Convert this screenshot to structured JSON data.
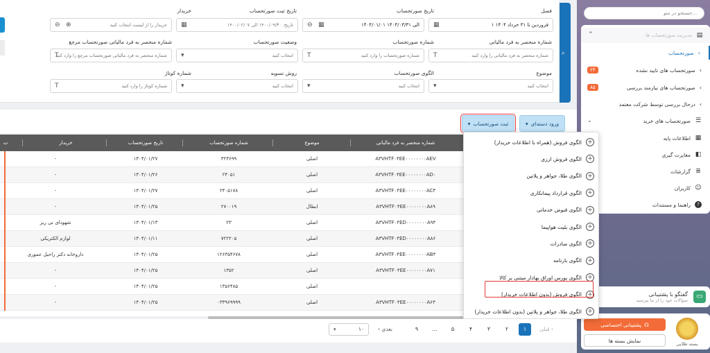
{
  "sidebar": {
    "search_placeholder": "جستجو در منو...",
    "group_faded": "مدیریت صورتحساب ها",
    "items": [
      {
        "label": "صورتحساب"
      },
      {
        "label": "صورتحساب های تایید نشده",
        "badge": "۲۳"
      },
      {
        "label": "صورتحساب های نیازمند بررسی",
        "badge": "۸۵"
      },
      {
        "label": "درحال بررسی توسط شرکت معتمد"
      },
      {
        "label": "صورتحساب های خرید"
      },
      {
        "label": "اطلاعات پایه"
      },
      {
        "label": "مغایرت گیری"
      },
      {
        "label": "گزارشات"
      },
      {
        "label": "کاربران"
      },
      {
        "label": "راهنما و مستندات"
      }
    ],
    "chat": {
      "title": "گفتگو با پشتیبانی",
      "subtitle": "سوالات خود را از ما بپرسید"
    },
    "package": {
      "support_button": "پشتیبانی اختصاصی",
      "show_button": "نمایش بسته ها",
      "medal_label": "بسته طلایی"
    }
  },
  "filters": {
    "row1": {
      "season": {
        "label": "فصل",
        "value": "۱ فروردین تا ۳۱ خرداد ۱۴۰۴"
      },
      "invoice_date": {
        "label": "تاریخ صورتحساب",
        "value": "۱۴۰۴/۰۱/۰۱ الی ۱۴۰۴/۰۳/۳۱"
      },
      "register_date": {
        "label": "تاریخ ثبت صورتحساب",
        "value": "تاریخ: ۱۴۰۰/۰۹/۳۰ الی ۱۴۰۰/۰۲/۰۷"
      },
      "buyer": {
        "label": "خریدار",
        "placeholder": "خریدار را از لیست انتخاب کنید"
      }
    },
    "row2": {
      "tax_number": {
        "label": "شماره منحصر به فرد مالیاتی",
        "placeholder": "شماره منحصر به فرد مالیاتی را وارد کنید"
      },
      "invoice_number": {
        "label": "شماره صورتحساب",
        "placeholder": "شماره صورتحساب را وارد کنید"
      },
      "status": {
        "label": "وضعیت صورتحساب",
        "placeholder": "انتخاب کنید"
      },
      "ref_tax_number": {
        "label": "شماره منحصر به فرد مالیاتی صورتحساب مرجع",
        "placeholder": "شماره منحصر به فرد مالیاتی صورتحساب مرجع را وارد کنید"
      }
    },
    "row3": {
      "subject": {
        "label": "موضوع",
        "placeholder": "انتخاب کنید"
      },
      "pattern": {
        "label": "الگوی صورتحساب",
        "placeholder": "انتخاب کنید"
      },
      "settlement": {
        "label": "روش تسویه",
        "placeholder": "انتخاب کنید"
      },
      "customs": {
        "label": "شماره کوتاژ",
        "placeholder": "شماره کوتاژ را وارد کنید"
      }
    }
  },
  "toolbar": {
    "group_import": "ورود دسته‌ای",
    "register_invoice": "ثبت صورتحساب"
  },
  "table": {
    "headers": {
      "tax_no": "شماره منحصر به فرد مالیاتی",
      "subject": "موضوع",
      "invoice_no": "شماره صورتحساب",
      "date": "تاریخ صورتحساب",
      "buyer": "خریدار",
      "col_first": "ت"
    },
    "rows": [
      {
        "tax_no": "A۳VHTF۰۴EE۰۰۰۰۰۰۰۰AEV",
        "subject": "اصلی",
        "invoice_no": "۳۲۳۶۹۹",
        "date": "۱۴۰۴/۰۱/۲۷",
        "buyer": "-"
      },
      {
        "tax_no": "A۳VHTF۰۴EE۰۰۰۰۰۰۰۰AD۰",
        "subject": "اصلی",
        "invoice_no": "۲۴۰۵۱",
        "date": "۱۴۰۴/۰۱/۲۶",
        "buyer": "-"
      },
      {
        "tax_no": "A۳VHTF۰۴EE۰۰۰۰۰۰۰۰AC۳",
        "subject": "اصلی",
        "invoice_no": "۲۴۰۵۱۷۸",
        "date": "۱۴۰۴/۰۱/۲۷",
        "buyer": "-"
      },
      {
        "tax_no": "A۳VHTF۰۴EE۰۰۰۰۰۰۰۰A۸۹",
        "subject": "ابطال",
        "invoice_no": "۲۷۰۰۱۹",
        "date": "۱۴۰۴/۰۱/۲۵",
        "buyer": "-"
      },
      {
        "tax_no": "A۳VHTF۰۴ED۰۰۰۰۰۰۰۰A۹۴",
        "subject": "اصلی",
        "invoice_no": "۲۳",
        "date": "۱۴۰۴/۰۱/۱۳",
        "buyer": "شهودای نی ریز"
      },
      {
        "tax_no": "A۳VHTF۰۴ED۰۰۰۰۰۰۰۰A۸۶",
        "subject": "اصلی",
        "invoice_no": "۷۲۲۲۰۵",
        "date": "۱۴۰۴/۰۱/۱۱",
        "buyer": "لوازم الکتریکی"
      },
      {
        "tax_no": "A۳VHTF۰۴EE۰۰۰۰۰۰۰۰AB۳",
        "subject": "اصلی",
        "invoice_no": "۱۲۶۳۵۴۶۷۸",
        "date": "۱۴۰۴/۰۱/۲۵",
        "buyer": "داروخانه دکتر راحیل عموری"
      },
      {
        "tax_no": "A۳VHTF۰۴EE۰۰۰۰۰۰۰۰A۷۱",
        "subject": "اصلی",
        "invoice_no": "۱۳۵۲",
        "date": "۱۴۰۴/۰۱/۲۵",
        "buyer": "-"
      },
      {
        "tax_no": "",
        "subject": "اصلی",
        "invoice_no": "۱۳۵۶۴۸۵",
        "date": "۱۴۰۴/۰۱/۲۵",
        "buyer": "-"
      },
      {
        "tax_no": "A۳VHTF۰۴EE۰۰۰۰۰۰۰۰A۶۳",
        "subject": "اصلی",
        "invoice_no": "۰۳۳۹۶۹۹۹۹",
        "date": "۱۴۰۴/۰۱/۲۵",
        "buyer": "-"
      }
    ]
  },
  "dropdown": {
    "items": [
      "الگوی فروش (همراه با اطلاعات خریدار)",
      "الگوی فروش ارزی",
      "الگوی طلا، جواهر و پلاتین",
      "الگوی قرارداد پیمانکاری",
      "الگوی قبوض خدماتی",
      "الگوی بلیت هواپیما",
      "الگوی صادرات",
      "الگوی بارنامه",
      "الگوی بورس اوراق بهادار مبتنی بر کالا",
      "الگوی فروش (بدون اطلاعات خریدار)",
      "الگوی طلا، جواهر و پلاتین (بدون اطلاعات خریدار)"
    ]
  },
  "pagination": {
    "prev": "قبلی",
    "next": "بعدی",
    "pages": [
      "۱",
      "۲",
      "۳",
      "۴",
      "۵",
      "...",
      "۹"
    ],
    "page_size": "۱۰"
  }
}
